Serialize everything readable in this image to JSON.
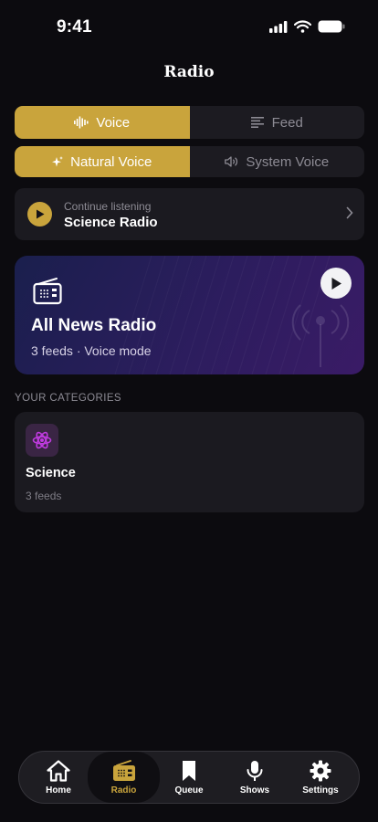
{
  "status": {
    "time": "9:41"
  },
  "page": {
    "title": "Radio"
  },
  "mode_toggle": {
    "voice": "Voice",
    "feed": "Feed",
    "active": "voice"
  },
  "voice_toggle": {
    "natural": "Natural Voice",
    "system": "System Voice",
    "active": "natural"
  },
  "continue": {
    "subtitle": "Continue listening",
    "title": "Science Radio"
  },
  "hero": {
    "title": "All News Radio",
    "subtitle": "3 feeds · Voice mode"
  },
  "categories": {
    "header": "YOUR CATEGORIES",
    "items": [
      {
        "name": "Science",
        "count": "3 feeds",
        "icon": "atom-icon"
      }
    ]
  },
  "tabbar": {
    "items": [
      {
        "label": "Home",
        "icon": "home-icon"
      },
      {
        "label": "Radio",
        "icon": "radio-icon",
        "active": true
      },
      {
        "label": "Queue",
        "icon": "bookmark-icon"
      },
      {
        "label": "Shows",
        "icon": "microphone-icon"
      },
      {
        "label": "Settings",
        "icon": "gear-icon"
      }
    ]
  },
  "colors": {
    "accent": "#c9a43c",
    "background": "#0c0b0f",
    "card": "#1b1a20",
    "category_icon": "#c03be0"
  }
}
